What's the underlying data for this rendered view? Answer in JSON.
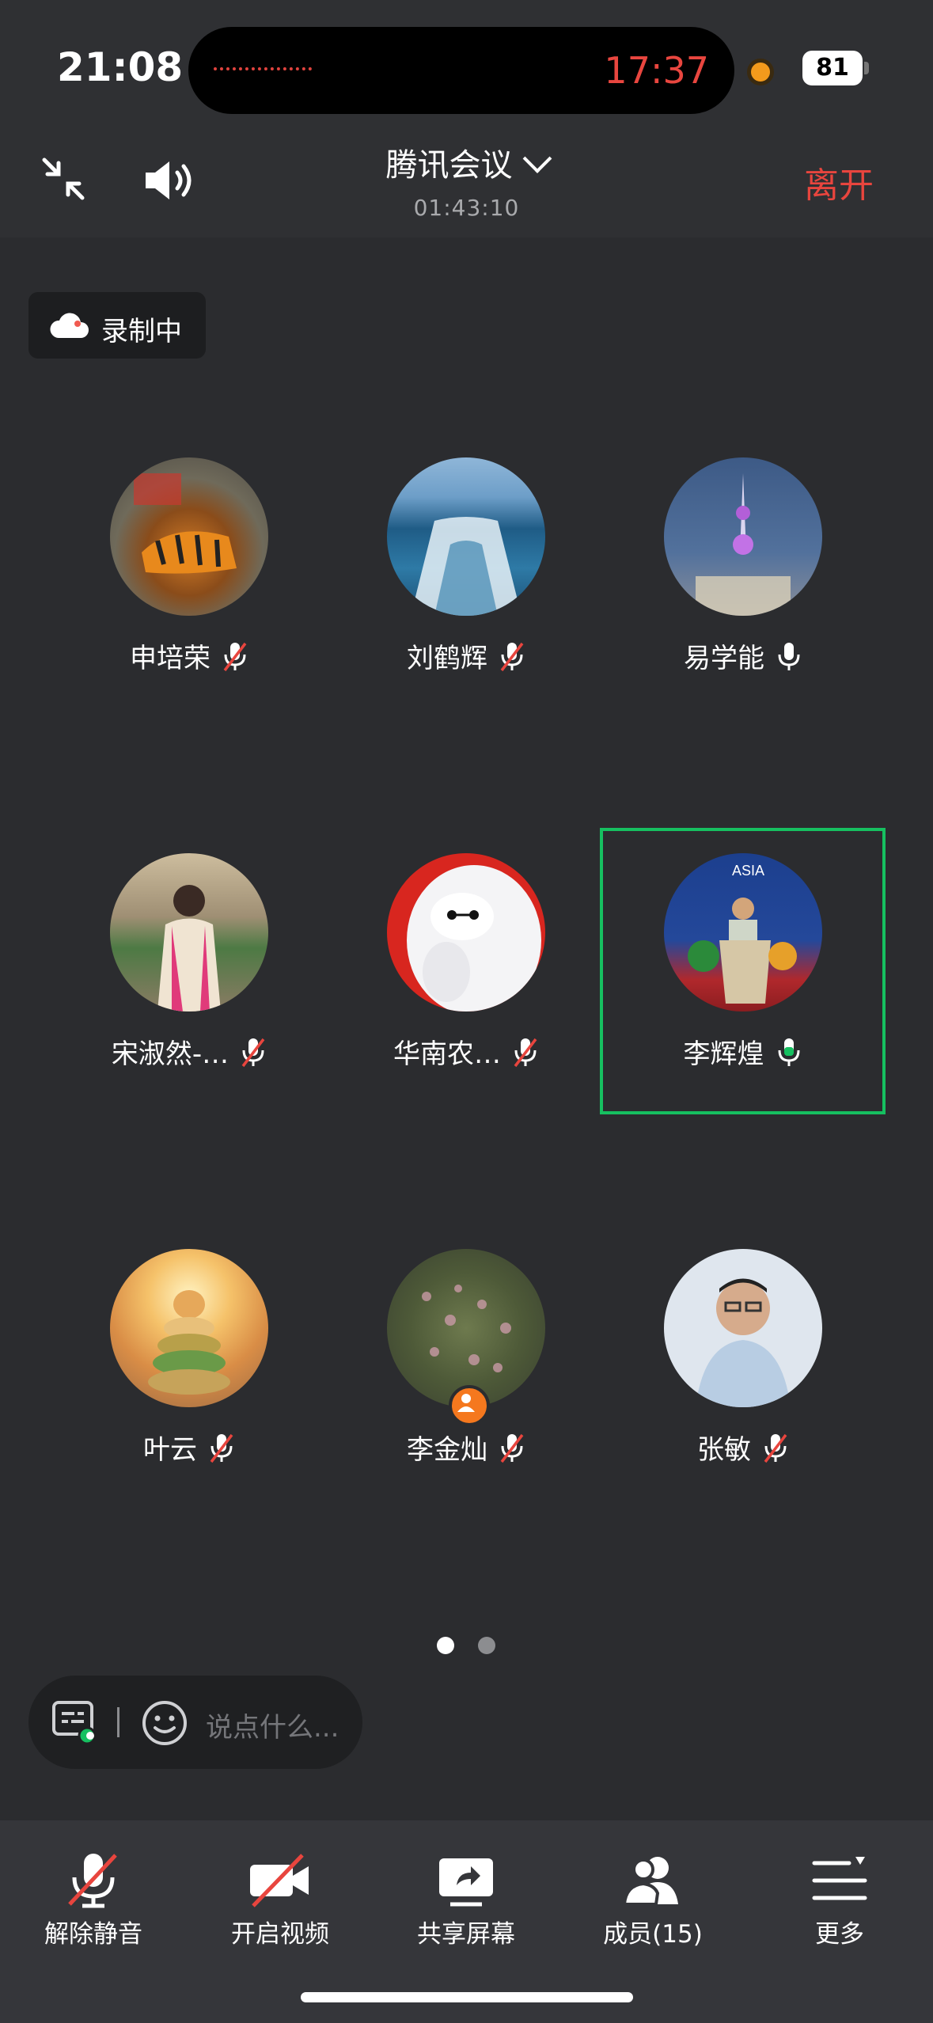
{
  "status": {
    "time": "21:08",
    "call_timer": "17:37",
    "battery": "81"
  },
  "header": {
    "title": "腾讯会议",
    "duration": "01:43:10",
    "leave_label": "离开"
  },
  "recording": {
    "label": "录制中"
  },
  "participants": [
    {
      "name": "申培荣",
      "mic": "muted"
    },
    {
      "name": "刘鹤辉",
      "mic": "muted"
    },
    {
      "name": "易学能",
      "mic": "on"
    },
    {
      "name": "宋淑然-…",
      "mic": "muted"
    },
    {
      "name": "华南农…",
      "mic": "muted"
    },
    {
      "name": "李辉煌",
      "mic": "speaking"
    },
    {
      "name": "叶云",
      "mic": "muted"
    },
    {
      "name": "李金灿",
      "mic": "muted"
    },
    {
      "name": "张敏",
      "mic": "muted"
    }
  ],
  "pagination": {
    "current": 1,
    "total": 2
  },
  "chat": {
    "placeholder": "说点什么..."
  },
  "toolbar": {
    "unmute": "解除静音",
    "video": "开启视频",
    "share": "共享屏幕",
    "members": "成员(15)",
    "more": "更多"
  },
  "colors": {
    "accent_red": "#e8453e",
    "speaking_green": "#16c060",
    "background": "#2b2c2f"
  }
}
